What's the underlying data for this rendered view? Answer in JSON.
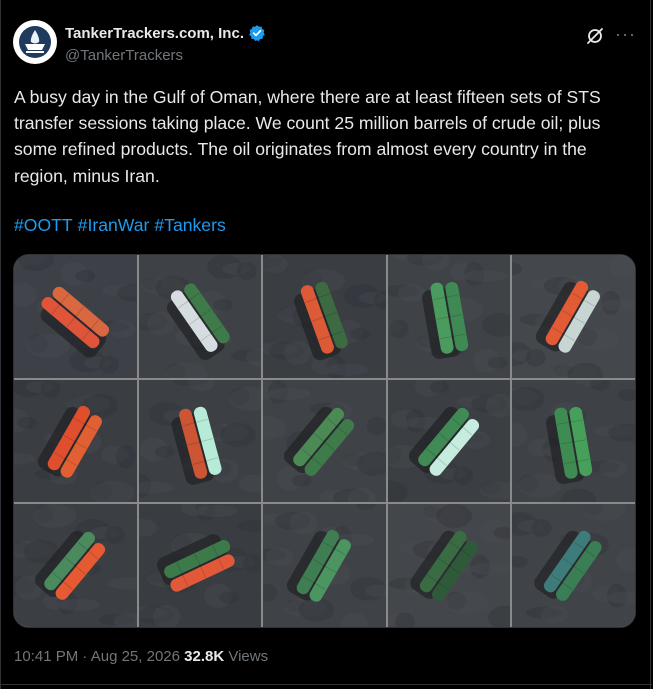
{
  "author": {
    "display_name": "TankerTrackers.com, Inc.",
    "handle": "@TankerTrackers",
    "verified_color": "#1d9bf0"
  },
  "actions": {
    "grok_icon": "grok-icon",
    "more_label": "···"
  },
  "post": {
    "text": "A busy day in the Gulf of Oman, where there are at least fifteen sets of STS transfer sessions taking place. We count 25 million barrels of crude oil; plus some refined products. The oil originates from almost every country in the region, minus Iran.",
    "hashtags": [
      "#OOTT",
      "#IranWar",
      "#Tankers"
    ]
  },
  "media": {
    "tiles": [
      {
        "a": "#e0553a",
        "b": "#d9673f",
        "bg": "#3d4046",
        "angle": -50
      },
      {
        "a": "#d6dde0",
        "b": "#3f7a4a",
        "bg": "#3e4145",
        "angle": -35
      },
      {
        "a": "#dd5a36",
        "b": "#3c6b42",
        "bg": "#3a3d42",
        "angle": -20
      },
      {
        "a": "#4a9b5d",
        "b": "#3f8a54",
        "bg": "#3f4247",
        "angle": -10
      },
      {
        "a": "#e35b35",
        "b": "#c7d6d3",
        "bg": "#44474b",
        "angle": 30
      },
      {
        "a": "#df4f2e",
        "b": "#e06033",
        "bg": "#3a3d42",
        "angle": 30
      },
      {
        "a": "#cc5533",
        "b": "#b8ead8",
        "bg": "#3c3f44",
        "angle": -15
      },
      {
        "a": "#4b8a55",
        "b": "#3f7a4a",
        "bg": "#3f4246",
        "angle": 40
      },
      {
        "a": "#3f8a55",
        "b": "#c5ecdf",
        "bg": "#3b3e43",
        "angle": 40
      },
      {
        "a": "#3f8c52",
        "b": "#47a05a",
        "bg": "#3e4145",
        "angle": -10
      },
      {
        "a": "#4a8a5c",
        "b": "#e65a33",
        "bg": "#3b3f44",
        "angle": 40
      },
      {
        "a": "#3c7a4a",
        "b": "#e2593a",
        "bg": "#393c41",
        "angle": 65
      },
      {
        "a": "#3f7e52",
        "b": "#4b9560",
        "bg": "#3f4247",
        "angle": 30
      },
      {
        "a": "#3a6c44",
        "b": "#2f5a3a",
        "bg": "#43464a",
        "angle": 35
      },
      {
        "a": "#3d7c7a",
        "b": "#3a7e55",
        "bg": "#404449",
        "angle": 35
      }
    ]
  },
  "meta": {
    "time": "10:41 PM",
    "separator": " · ",
    "date": "Aug 25, 2026",
    "views_count": "32.8K",
    "views_label": "Views"
  }
}
